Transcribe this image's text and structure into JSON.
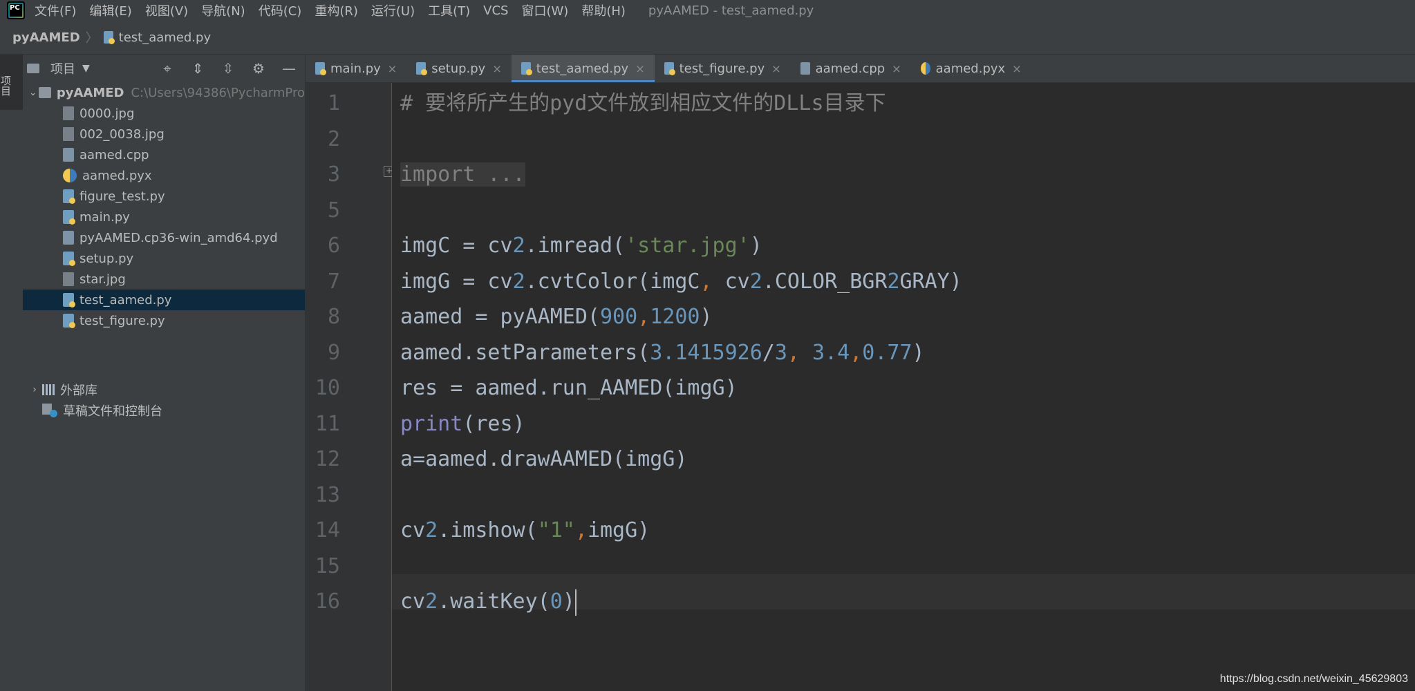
{
  "menubar": {
    "items": [
      "文件(F)",
      "编辑(E)",
      "视图(V)",
      "导航(N)",
      "代码(C)",
      "重构(R)",
      "运行(U)",
      "工具(T)",
      "VCS",
      "窗口(W)",
      "帮助(H)"
    ],
    "window_title": "pyAAMED - test_aamed.py"
  },
  "breadcrumb": {
    "root": "pyAAMED",
    "file": "test_aamed.py"
  },
  "left_strip": {
    "project_tab": "项目"
  },
  "project_panel": {
    "title": "项目",
    "root": {
      "name": "pyAAMED",
      "path": "C:\\Users\\94386\\PycharmPro"
    },
    "files": [
      {
        "name": "0000.jpg",
        "type": "jpg"
      },
      {
        "name": "002_0038.jpg",
        "type": "jpg"
      },
      {
        "name": "aamed.cpp",
        "type": "cpp"
      },
      {
        "name": "aamed.pyx",
        "type": "pyx"
      },
      {
        "name": "figure_test.py",
        "type": "py"
      },
      {
        "name": "main.py",
        "type": "py"
      },
      {
        "name": "pyAAMED.cp36-win_amd64.pyd",
        "type": "pyd"
      },
      {
        "name": "setup.py",
        "type": "py"
      },
      {
        "name": "star.jpg",
        "type": "jpg"
      },
      {
        "name": "test_aamed.py",
        "type": "py",
        "selected": true
      },
      {
        "name": "test_figure.py",
        "type": "py"
      }
    ],
    "external_libs": "外部库",
    "scratches": "草稿文件和控制台"
  },
  "tabs": [
    {
      "label": "main.py",
      "type": "py"
    },
    {
      "label": "setup.py",
      "type": "py"
    },
    {
      "label": "test_aamed.py",
      "type": "py",
      "active": true
    },
    {
      "label": "test_figure.py",
      "type": "py"
    },
    {
      "label": "aamed.cpp",
      "type": "cpp"
    },
    {
      "label": "aamed.pyx",
      "type": "pyx"
    }
  ],
  "editor": {
    "line_numbers": [
      "1",
      "2",
      "3",
      "5",
      "6",
      "7",
      "8",
      "9",
      "10",
      "11",
      "12",
      "13",
      "14",
      "15",
      "16"
    ],
    "lines": [
      "# 要将所产生的pyd文件放到相应文件的DLLs目录下",
      "",
      "import ...",
      "",
      "imgC = cv2.imread('star.jpg')",
      "imgG = cv2.cvtColor(imgC, cv2.COLOR_BGR2GRAY)",
      "aamed = pyAAMED(900,1200)",
      "aamed.setParameters(3.1415926/3, 3.4,0.77)",
      "res = aamed.run_AAMED(imgG)",
      "print(res)",
      "a=aamed.drawAAMED(imgG)",
      "",
      "cv2.imshow(\"1\",imgG)",
      "",
      "cv2.waitKey(0)"
    ],
    "current_line": "16"
  },
  "watermark": "https://blog.csdn.net/weixin_45629803",
  "colors": {
    "background": "#2b2b2b",
    "panel": "#3c3f41",
    "accent": "#4a88c7",
    "selected_row": "#0d293e"
  }
}
